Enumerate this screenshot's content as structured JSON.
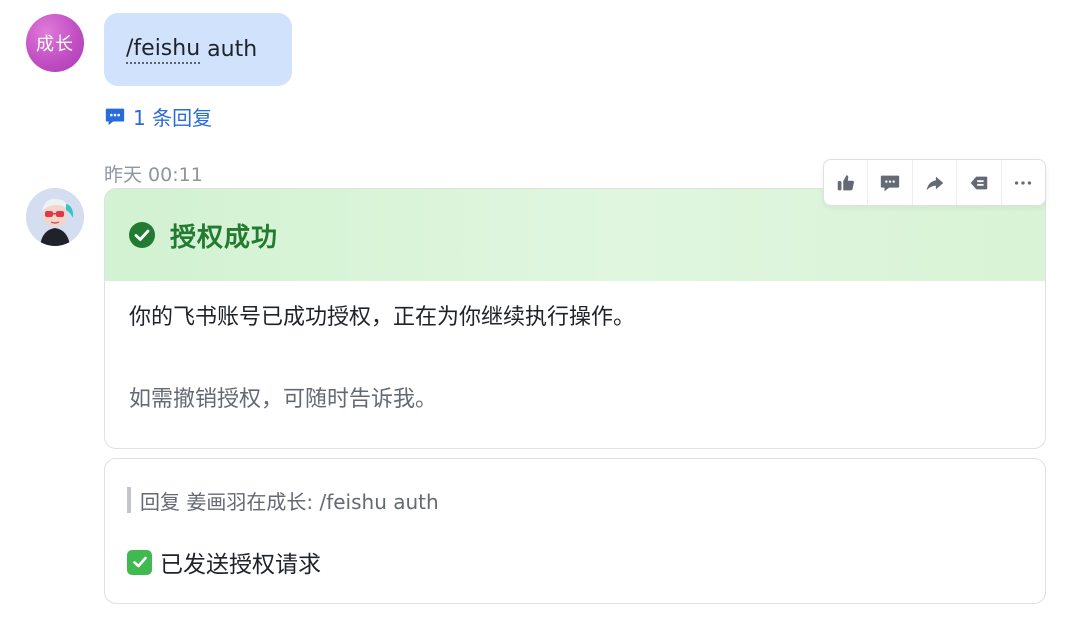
{
  "user_message": {
    "avatar_text": "成长",
    "command": "/feishu",
    "command_arg": "auth",
    "reply_count_label": "1 条回复"
  },
  "bot_message": {
    "timestamp": "昨天 00:11",
    "card": {
      "title": "授权成功",
      "body": "你的飞书账号已成功授权，正在为你继续执行操作。",
      "note": "如需撤销授权，可随时告诉我。"
    },
    "toolbar": {
      "icons": [
        "thumbs-up-icon",
        "comment-icon",
        "forward-icon",
        "reply-icon",
        "more-icon"
      ]
    },
    "reply": {
      "quote": "回复 姜画羽在成长: /feishu auth",
      "text": "已发送授权请求"
    }
  },
  "colors": {
    "bubble": "#d1e2fd",
    "link": "#2a6bdb",
    "success_green": "#237a31",
    "check_green": "#3fb950"
  }
}
